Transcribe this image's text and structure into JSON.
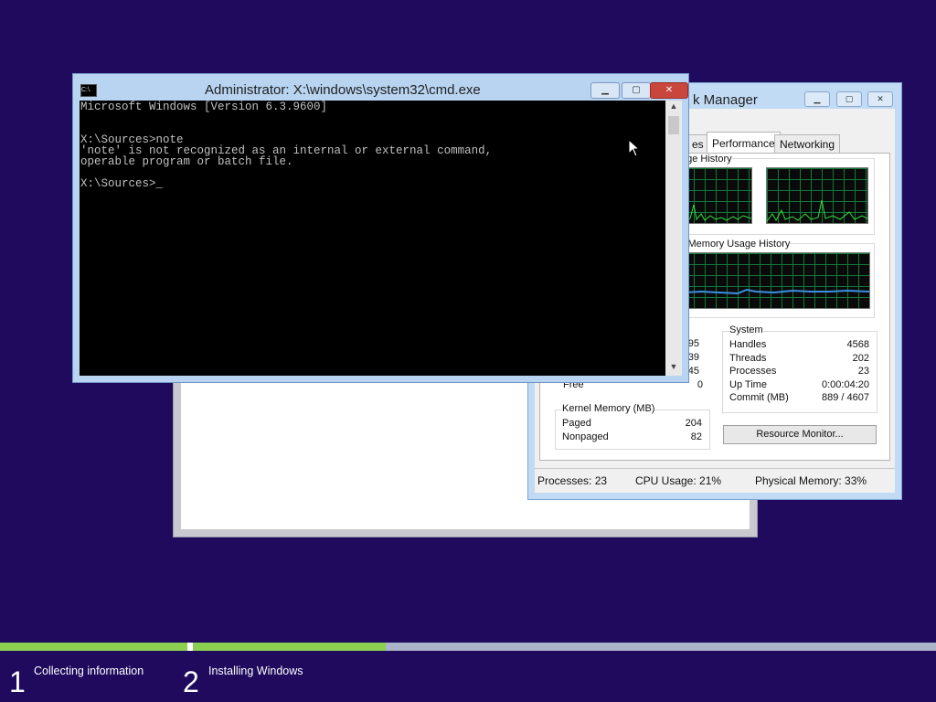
{
  "setup": {
    "steps": [
      {
        "number": "1",
        "label": "Collecting information"
      },
      {
        "number": "2",
        "label": "Installing Windows"
      }
    ],
    "progress": {
      "step1_complete": 1.0,
      "step2_fraction": 0.26
    }
  },
  "task_manager": {
    "title": "k Manager",
    "tabs": [
      "es",
      "Performance",
      "Networking"
    ],
    "active_tab": "Performance",
    "cpu_history_label": "age History",
    "memory_history_label": "l Memory Usage History",
    "partial_values": [
      "95",
      "39",
      "45"
    ],
    "free_label": "Free",
    "free_value": "0",
    "system": {
      "label": "System",
      "rows": [
        {
          "k": "Handles",
          "v": "4568"
        },
        {
          "k": "Threads",
          "v": "202"
        },
        {
          "k": "Processes",
          "v": "23"
        },
        {
          "k": "Up Time",
          "v": "0:00:04:20"
        },
        {
          "k": "Commit (MB)",
          "v": "889 / 4607"
        }
      ]
    },
    "kernel": {
      "label": "Kernel Memory (MB)",
      "rows": [
        {
          "k": "Paged",
          "v": "204"
        },
        {
          "k": "Nonpaged",
          "v": "82"
        }
      ]
    },
    "resource_monitor_label": "Resource Monitor...",
    "status": {
      "processes": "Processes: 23",
      "cpu": "CPU Usage: 21%",
      "memory": "Physical Memory: 33%"
    }
  },
  "cmd": {
    "title": "Administrator: X:\\windows\\system32\\cmd.exe",
    "icon_text": "C:\\.",
    "lines": [
      "Microsoft Windows [Version 6.3.9600]",
      "",
      "X:\\Sources>note",
      "'note' is not recognized as an internal or external command,",
      "operable program or batch file.",
      "",
      "X:\\Sources>_"
    ]
  },
  "colors": {
    "desktop": "#1f0a5e",
    "progress_green": "#8bd050",
    "graph_grid": "#127a3a",
    "graph_line": "#34e03a",
    "mem_line": "#3b8fe0"
  }
}
